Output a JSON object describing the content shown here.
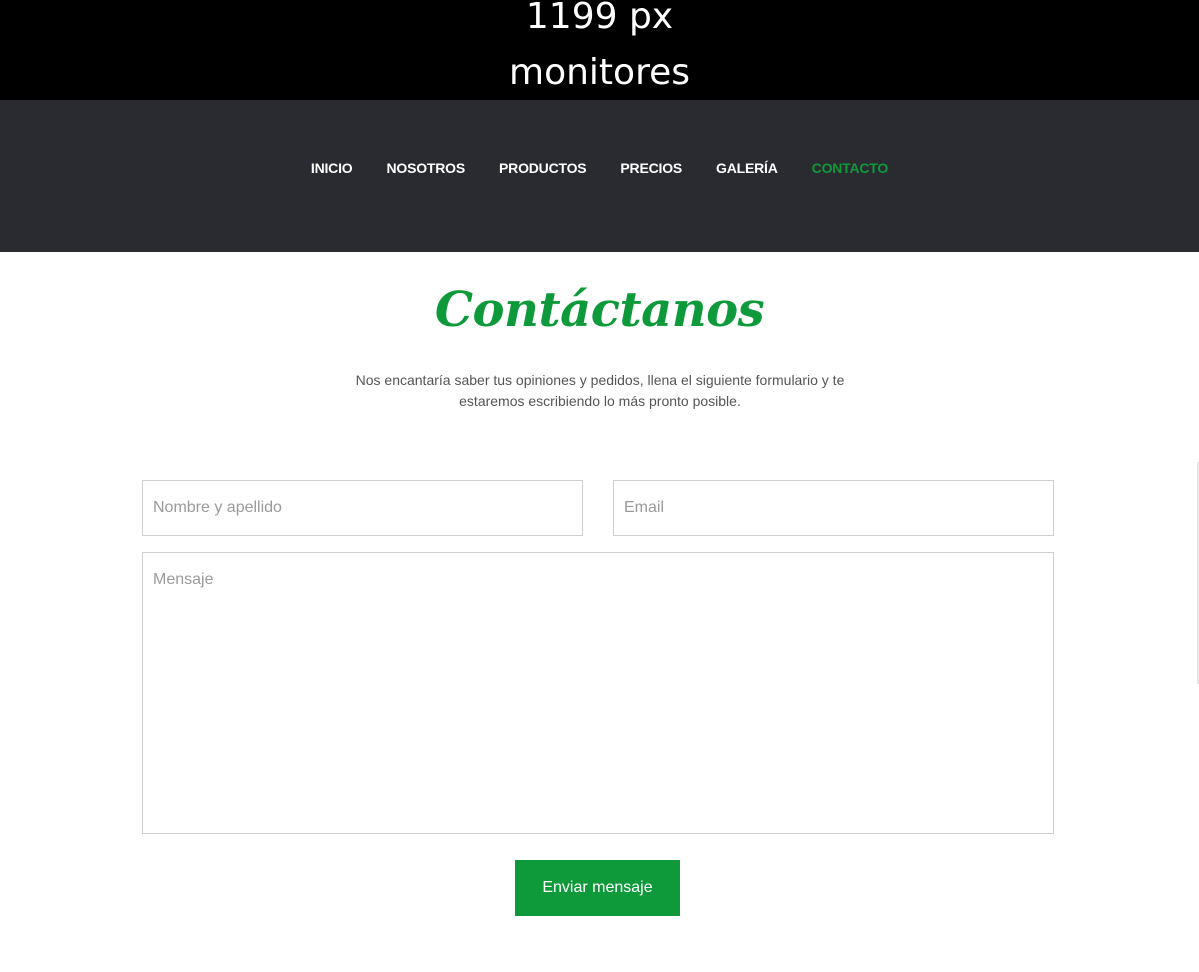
{
  "banner": {
    "line1": "1199 px",
    "line2": "monitores"
  },
  "nav": {
    "items": [
      {
        "label": "INICIO",
        "active": false
      },
      {
        "label": "NOSOTROS",
        "active": false
      },
      {
        "label": "PRODUCTOS",
        "active": false
      },
      {
        "label": "PRECIOS",
        "active": false
      },
      {
        "label": "GALERÍA",
        "active": false
      },
      {
        "label": "CONTACTO",
        "active": true
      }
    ]
  },
  "contact": {
    "title": "Contáctanos",
    "intro": "Nos encantaría saber tus opiniones y pedidos, llena el siguiente formulario y te estaremos escribiendo lo más pronto posible.",
    "name_placeholder": "Nombre y apellido",
    "name_value": "",
    "email_placeholder": "Email",
    "email_value": "",
    "message_placeholder": "Mensaje",
    "message_value": "",
    "submit_label": "Enviar mensaje"
  },
  "colors": {
    "accent": "#0e9a3a",
    "navbar_bg": "#2a2b30",
    "banner_bg": "#000000"
  }
}
